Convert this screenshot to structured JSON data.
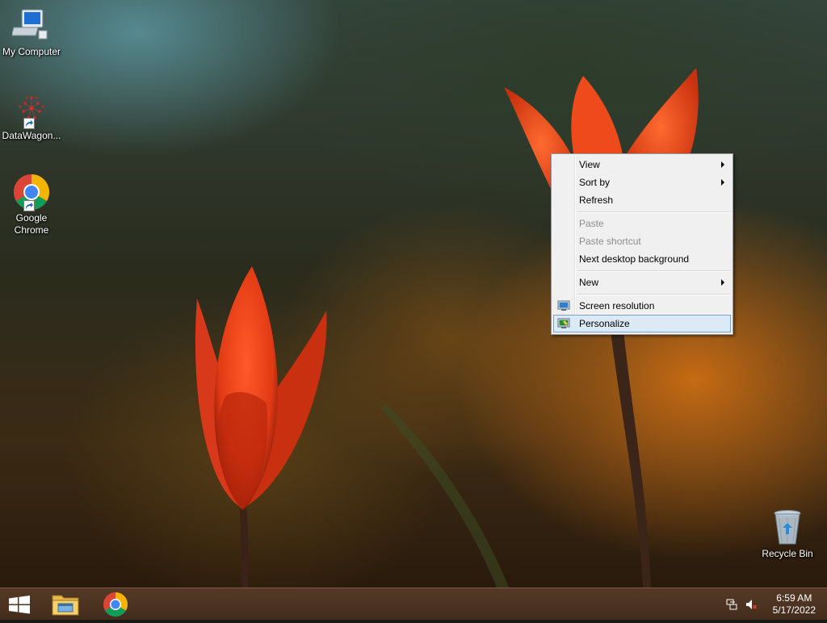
{
  "desktop": {
    "icons": [
      {
        "label": "My Computer",
        "icon": "computer-icon"
      },
      {
        "label": "DataWagon...",
        "icon": "datawagon-icon"
      },
      {
        "label": "Google Chrome",
        "icon": "chrome-icon"
      },
      {
        "label": "Recycle Bin",
        "icon": "recycle-bin-icon"
      }
    ]
  },
  "context_menu": {
    "items": [
      {
        "label": "View",
        "submenu": true,
        "enabled": true
      },
      {
        "label": "Sort by",
        "submenu": true,
        "enabled": true
      },
      {
        "label": "Refresh",
        "enabled": true
      },
      {
        "label": "Paste",
        "enabled": false
      },
      {
        "label": "Paste shortcut",
        "enabled": false
      },
      {
        "label": "Next desktop background",
        "enabled": true
      },
      {
        "label": "New",
        "submenu": true,
        "enabled": true
      },
      {
        "label": "Screen resolution",
        "icon": "monitor-icon",
        "enabled": true
      },
      {
        "label": "Personalize",
        "icon": "personalize-icon",
        "enabled": true,
        "highlighted": true
      }
    ]
  },
  "taskbar": {
    "pinned": [
      {
        "name": "start-button",
        "icon": "windows-logo-icon"
      },
      {
        "name": "file-explorer",
        "icon": "folder-icon"
      },
      {
        "name": "chrome",
        "icon": "chrome-icon"
      }
    ],
    "tray": {
      "network_icon": "network-icon",
      "volume_icon": "volume-muted-icon",
      "time": "6:59 AM",
      "date": "5/17/2022"
    }
  },
  "colors": {
    "menu_bg": "#f0f0f0",
    "menu_highlight": "#dce9f7",
    "menu_highlight_border": "#7da2ce",
    "taskbar": "#5a3c28",
    "disabled_text": "#8d8d8d"
  }
}
